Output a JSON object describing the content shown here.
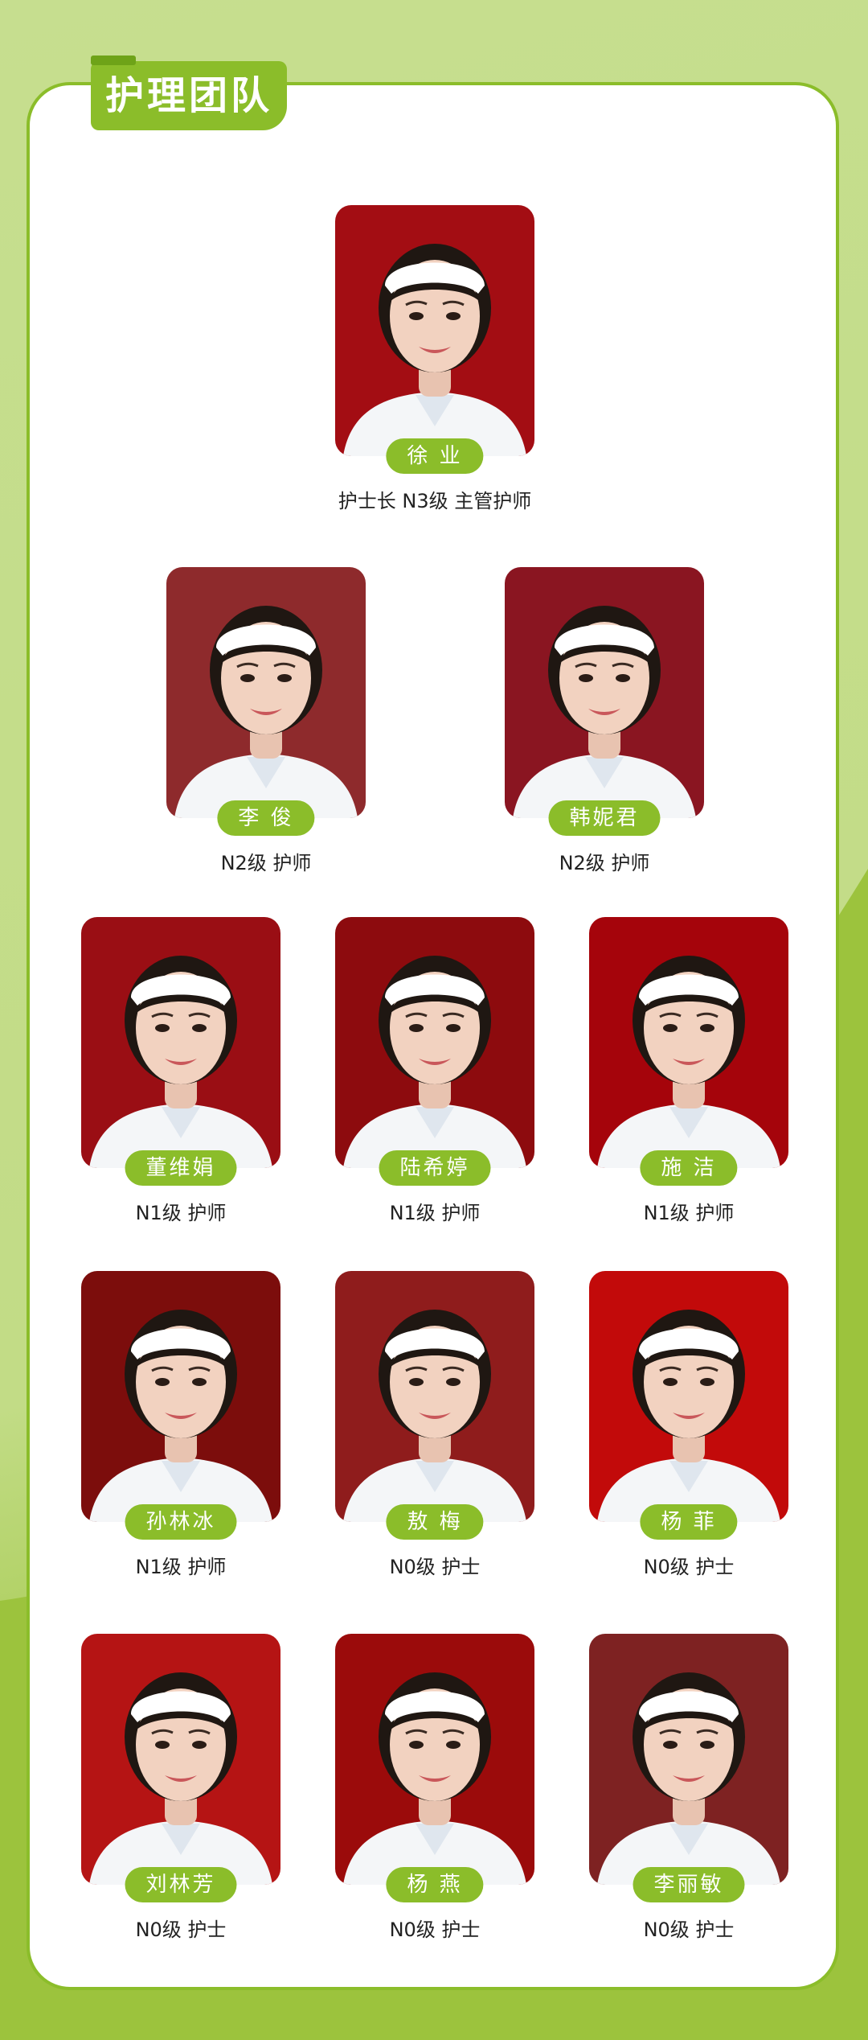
{
  "section": {
    "title": "护理团队"
  },
  "colors": {
    "accent": "#8bbd2a",
    "page_background": "#c6de8f",
    "photo_background_red": "#9e0f14"
  },
  "members": [
    {
      "name": "徐 业",
      "title": "护士长 N3级 主管护师",
      "photo_icon": "nurse-portrait-icon"
    },
    {
      "name": "李 俊",
      "title": "N2级 护师",
      "photo_icon": "nurse-portrait-icon"
    },
    {
      "name": "韩妮君",
      "title": "N2级 护师",
      "photo_icon": "nurse-portrait-icon"
    },
    {
      "name": "董维娟",
      "title": "N1级 护师",
      "photo_icon": "nurse-portrait-icon"
    },
    {
      "name": "陆希婷",
      "title": "N1级 护师",
      "photo_icon": "nurse-portrait-icon"
    },
    {
      "name": "施 洁",
      "title": "N1级 护师",
      "photo_icon": "nurse-portrait-icon"
    },
    {
      "name": "孙林冰",
      "title": "N1级 护师",
      "photo_icon": "nurse-portrait-icon"
    },
    {
      "name": "敖 梅",
      "title": "N0级 护士",
      "photo_icon": "nurse-portrait-icon"
    },
    {
      "name": "杨 菲",
      "title": "N0级 护士",
      "photo_icon": "nurse-portrait-icon"
    },
    {
      "name": "刘林芳",
      "title": "N0级 护士",
      "photo_icon": "nurse-portrait-icon"
    },
    {
      "name": "杨 燕",
      "title": "N0级 护士",
      "photo_icon": "nurse-portrait-icon"
    },
    {
      "name": "李丽敏",
      "title": "N0级 护士",
      "photo_icon": "nurse-portrait-icon"
    }
  ]
}
